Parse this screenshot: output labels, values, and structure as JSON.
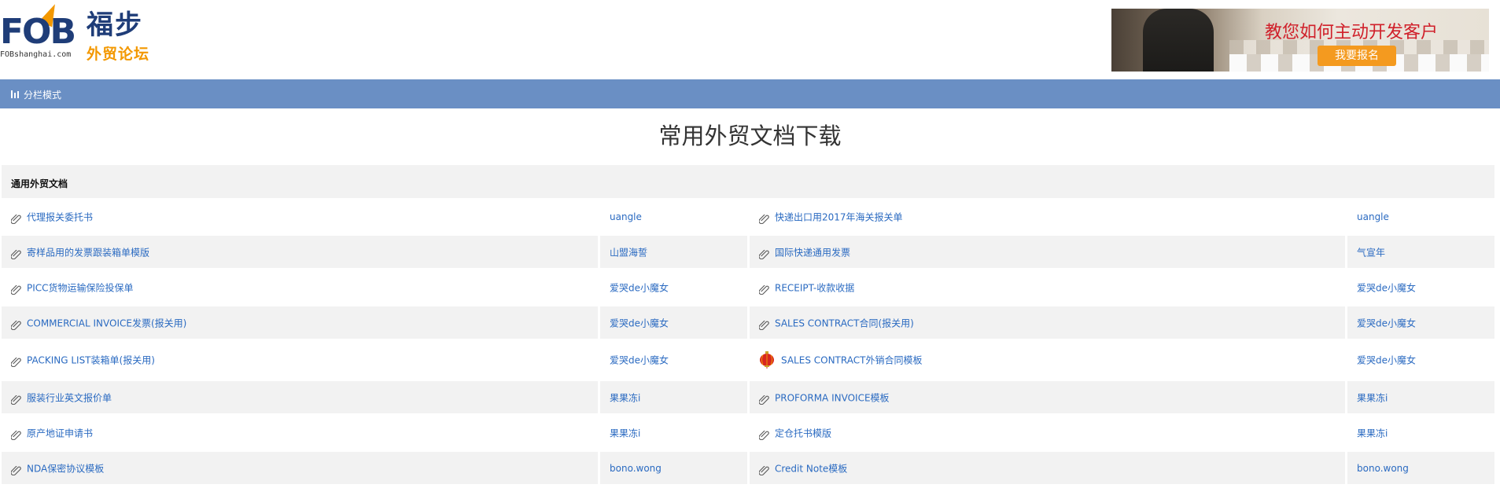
{
  "header": {
    "logo": {
      "mark": "FOB",
      "domain": "FOBshanghai.com",
      "name_cn": "福步",
      "sub_cn": "外贸论坛"
    },
    "banner": {
      "headline": "教您如何主动开发客户",
      "button_label": "我要报名"
    }
  },
  "nav_bar": {
    "mode_label": "分栏模式",
    "icon": "columns-icon"
  },
  "page_title": "常用外贸文档下载",
  "section": {
    "title": "通用外贸文档"
  },
  "rows": [
    {
      "left": {
        "title": "代理报关委托书",
        "author": "uangle"
      },
      "right": {
        "title": "快递出口用2017年海关报关单",
        "author": "uangle"
      }
    },
    {
      "left": {
        "title": "寄样品用的发票跟装箱单模版",
        "author": "山盟海誓"
      },
      "right": {
        "title": "国际快递通用发票",
        "author": "气宣年"
      }
    },
    {
      "left": {
        "title": "PICC货物运输保险投保单",
        "author": "爱哭de小魔女"
      },
      "right": {
        "title": "RECEIPT-收款收据",
        "author": "爱哭de小魔女"
      }
    },
    {
      "left": {
        "title": "COMMERCIAL INVOICE发票(报关用)",
        "author": "爱哭de小魔女"
      },
      "right": {
        "title": "SALES CONTRACT合同(报关用)",
        "author": "爱哭de小魔女"
      }
    },
    {
      "left": {
        "title": "PACKING LIST装箱单(报关用)",
        "author": "爱哭de小魔女"
      },
      "right": {
        "title": "SALES CONTRACT外销合同模板",
        "author": "爱哭de小魔女",
        "icon": "lantern-icon"
      }
    },
    {
      "left": {
        "title": "服装行业英文报价单",
        "author": "果果冻i"
      },
      "right": {
        "title": "PROFORMA INVOICE模板",
        "author": "果果冻i"
      }
    },
    {
      "left": {
        "title": "原产地证申请书",
        "author": "果果冻i"
      },
      "right": {
        "title": "定仓托书模版",
        "author": "果果冻i"
      }
    },
    {
      "left": {
        "title": "NDA保密协议模板",
        "author": "bono.wong"
      },
      "right": {
        "title": "Credit Note模板",
        "author": "bono.wong"
      }
    }
  ],
  "colors": {
    "nav_bar": "#6a8fc4",
    "link": "#2a6ac1",
    "row_shade": "#f2f2f2",
    "logo_blue": "#1f3d78",
    "logo_orange": "#f39800",
    "banner_red": "#d0202a"
  }
}
